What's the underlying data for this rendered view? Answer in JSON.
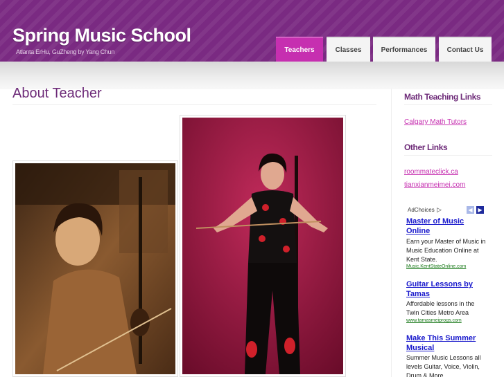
{
  "header": {
    "site_title": "Spring Music School",
    "tagline": "Atlanta ErHu, GuZheng by Yang Chun"
  },
  "nav": {
    "items": [
      {
        "label": "Teachers",
        "active": true
      },
      {
        "label": "Classes",
        "active": false
      },
      {
        "label": "Performances",
        "active": false
      },
      {
        "label": "Contact Us",
        "active": false
      }
    ]
  },
  "main": {
    "page_title": "About Teacher"
  },
  "sidebar": {
    "sections": [
      {
        "heading": "Math Teaching Links",
        "links": [
          "Calgary Math Tutors"
        ]
      },
      {
        "heading": "Other Links",
        "links": [
          "roommateclick.ca",
          "tianxianmeimei.com"
        ]
      }
    ]
  },
  "ads": {
    "adchoices_label": "AdChoices",
    "items": [
      {
        "title": "Master of Music Online",
        "text": "Earn your Master of Music in Music Education Online at Kent State.",
        "url": "Music.KentStateOnline.com"
      },
      {
        "title": "Guitar Lessons by Tamas",
        "text": "Affordable lessons in the Twin Cities Metro Area",
        "url": "www.tamasmeiprogs.com"
      },
      {
        "title": "Make This Summer Musical",
        "text": "Summer Music Lessons all levels Guitar, Voice, Violin, Drum & More",
        "url": ""
      }
    ]
  },
  "colors": {
    "brand_purple": "#7a2a82",
    "active_tab": "#c62fb0",
    "link_pink": "#c62fb0",
    "ad_link_blue": "#1a1acc"
  }
}
